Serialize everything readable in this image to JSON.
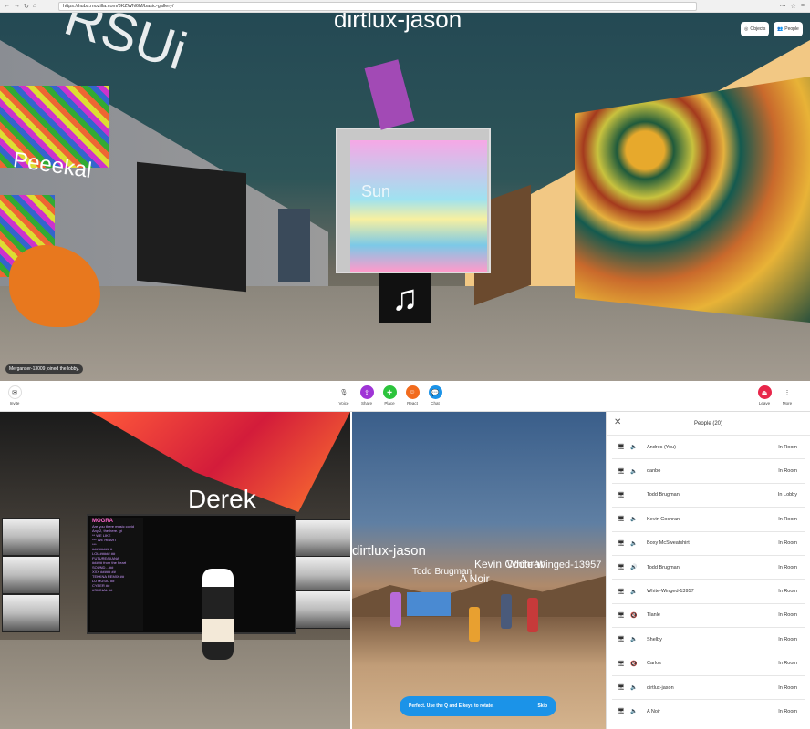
{
  "browser": {
    "url": "https://hubs.mozilla.com/3KZWN6M/basic-gallery/"
  },
  "top_scene": {
    "name_tags": [
      "RSUi",
      "dirtlux-jason",
      "Peeekal",
      "Sun"
    ],
    "toast": "Merganser-13009 joined the lobby.",
    "objects_label": "Objects",
    "people_label": "People"
  },
  "toolbar": {
    "invite": "Invite",
    "voice": "Voice",
    "share": "Share",
    "place": "Place",
    "react": "React",
    "chat": "Chat",
    "leave": "Leave",
    "more": "More",
    "colors": {
      "share": "#9f35d6",
      "place": "#2cc43c",
      "react": "#f26b1d",
      "chat": "#1b93e8",
      "leave": "#e8264a"
    }
  },
  "bottom_left": {
    "name_tag": "Derek",
    "screen_title": "MOGRA",
    "term_lines": [
      "Are you there music covid",
      "Any 2, the here. gt",
      "** WE LIKE",
      "*** WE HEART",
      "***",
      "### ##### #",
      "LOL ##### ##",
      "FUTURE/DIANA",
      "##### from the heart",
      "SOUND... ##",
      "XXX ##### ##",
      "TEKKNA REMIX ##",
      "DJ MUSIC ##",
      "CYBER ##",
      "#SIGNAL ##"
    ]
  },
  "bottom_mid": {
    "name_tags": [
      "dirtlux-jason",
      "Todd Brugman",
      "A Noir",
      "Kevin Cochran",
      "White-Winged-13957"
    ],
    "tip": "Perfect. Use the Q and E keys to rotate.",
    "skip": "Skip"
  },
  "people": {
    "title": "People (20)",
    "rows": [
      {
        "name": "Andres (You)",
        "status": "In Room",
        "muted": false
      },
      {
        "name": "danbo",
        "status": "In Room",
        "muted": false
      },
      {
        "name": "Todd Brugman",
        "status": "In Lobby",
        "muted": false
      },
      {
        "name": "Kevin Cochran",
        "status": "In Room",
        "muted": false
      },
      {
        "name": "Boxy McSweatshirt",
        "status": "In Room",
        "muted": false
      },
      {
        "name": "Todd Brugman",
        "status": "In Room",
        "muted": false
      },
      {
        "name": "White-Winged-13957",
        "status": "In Room",
        "muted": false
      },
      {
        "name": "Tlanle",
        "status": "In Room",
        "muted": true
      },
      {
        "name": "Shelby",
        "status": "In Room",
        "muted": false
      },
      {
        "name": "Carlos",
        "status": "In Room",
        "muted": true
      },
      {
        "name": "dirtlux-jason",
        "status": "In Room",
        "muted": false
      },
      {
        "name": "A Noir",
        "status": "In Room",
        "muted": false
      }
    ]
  }
}
